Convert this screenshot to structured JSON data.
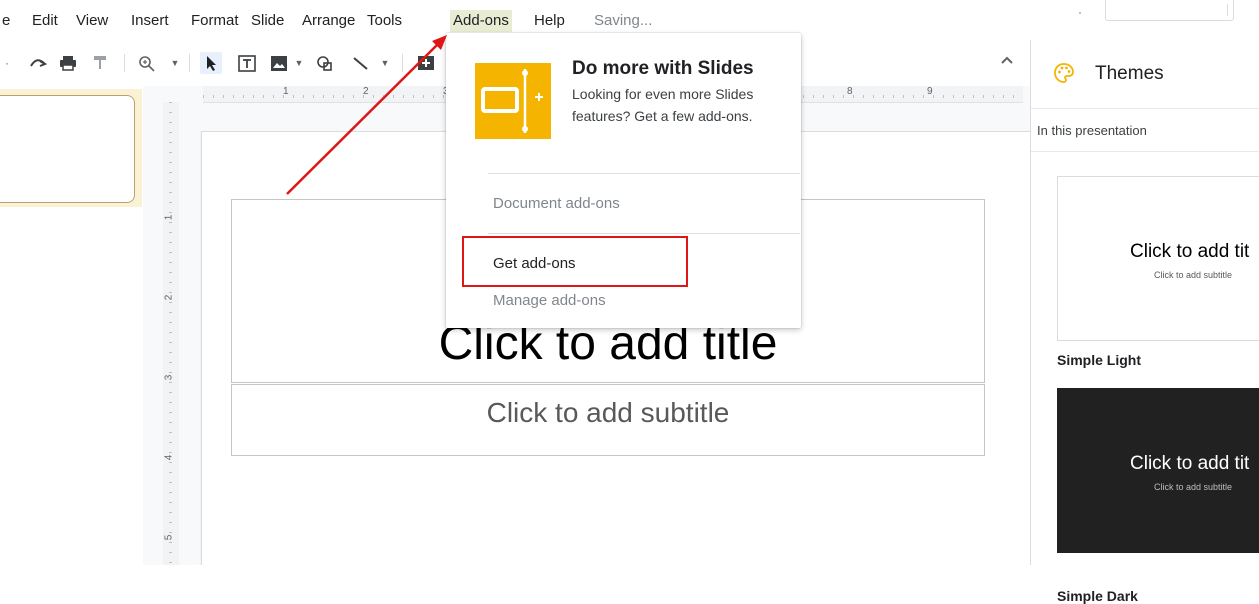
{
  "menubar": {
    "items": [
      "e",
      "Edit",
      "View",
      "Insert",
      "Format",
      "Slide",
      "Arrange",
      "Tools",
      "Add-ons",
      "Help"
    ],
    "status": "Saving..."
  },
  "toolbar": {
    "icons": [
      "redo-icon",
      "print-icon",
      "paint-format-icon",
      "zoom-icon",
      "select-icon",
      "text-box-icon",
      "image-icon",
      "shape-icon",
      "line-icon",
      "new-comment-icon"
    ]
  },
  "ruler": {
    "horizontal_numbers": [
      "1",
      "2",
      "3",
      "8",
      "9"
    ],
    "vertical_numbers": [
      "1",
      "2",
      "3",
      "4",
      "5"
    ]
  },
  "slide": {
    "title_placeholder": "Click to add title",
    "subtitle_placeholder": "Click to add subtitle"
  },
  "addons_menu": {
    "promo_title": "Do more with Slides",
    "promo_description": "Looking for even more Slides features? Get a few add-ons.",
    "document_addons": "Document add-ons",
    "get_addons": "Get add-ons",
    "manage_addons": "Manage add-ons"
  },
  "themes_panel": {
    "title": "Themes",
    "subtitle": "In this presentation",
    "themes": [
      {
        "name": "Simple Light",
        "title": "Click to add tit",
        "subtitle": "Click to add subtitle"
      },
      {
        "name": "Simple Dark",
        "title": "Click to add tit",
        "subtitle": "Click to add subtitle"
      }
    ]
  },
  "colors": {
    "addon_icon": "#f4b400",
    "annotation_red": "#e01616",
    "menu_active_bg": "#e8ecd2"
  }
}
